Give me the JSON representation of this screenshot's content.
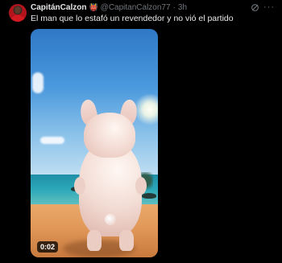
{
  "author": {
    "name": "CapitánCalzon",
    "name_emoji": "👹",
    "handle": "@CapitanCalzon77",
    "separator": "·",
    "time": "3h"
  },
  "tweet": {
    "text": "El man que lo estafó un revendedor y no vió el partido"
  },
  "media": {
    "type": "video",
    "duration": "0:02"
  },
  "icons": {
    "grok": "grok-icon",
    "more": "more-icon"
  },
  "colors": {
    "background": "#000000",
    "text_primary": "#e7e9ea",
    "text_secondary": "#71767b"
  }
}
